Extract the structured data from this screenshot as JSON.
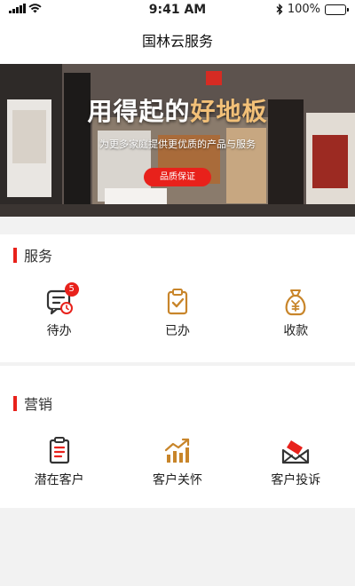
{
  "status_bar": {
    "wifi_icon": "wifi-icon",
    "time": "9:41 AM",
    "battery": "100%"
  },
  "nav": {
    "title": "国林云服务"
  },
  "banner": {
    "headline_a": "用得起的",
    "headline_b": "好地板",
    "subtitle": "为更多家庭提供更优质的产品与服务",
    "button_label": "品质保证"
  },
  "services": {
    "title": "服务",
    "items": [
      {
        "label": "待办",
        "icon": "todo-message-icon",
        "badge": "5"
      },
      {
        "label": "已办",
        "icon": "clipboard-check-icon"
      },
      {
        "label": "收款",
        "icon": "money-bag-icon"
      }
    ]
  },
  "marketing": {
    "title": "营销",
    "items": [
      {
        "label": "潜在客户",
        "icon": "document-list-icon"
      },
      {
        "label": "客户关怀",
        "icon": "trend-chart-icon"
      },
      {
        "label": "客户投诉",
        "icon": "envelope-icon"
      }
    ]
  },
  "colors": {
    "accent": "#e8211b",
    "icon": "#c8852a",
    "dark_icon": "#333333"
  }
}
